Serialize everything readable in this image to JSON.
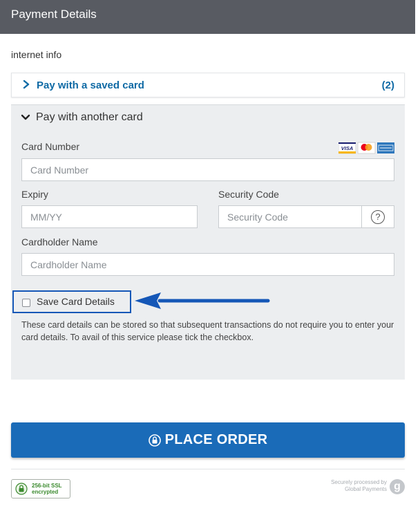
{
  "header": {
    "title": "Payment Details"
  },
  "merchant_info": "internet info",
  "saved_card": {
    "label": "Pay with a saved card",
    "count": "(2)"
  },
  "new_card": {
    "title": "Pay with another card",
    "card_number": {
      "label": "Card Number",
      "placeholder": "Card Number"
    },
    "card_logos": [
      "visa-logo",
      "mastercard-logo",
      "amex-logo"
    ],
    "expiry": {
      "label": "Expiry",
      "placeholder": "MM/YY"
    },
    "security_code": {
      "label": "Security Code",
      "placeholder": "Security Code",
      "help": "?"
    },
    "cardholder": {
      "label": "Cardholder Name",
      "placeholder": "Cardholder Name"
    },
    "save_card": {
      "label": "Save Card Details",
      "checked": false
    },
    "save_description": "These card details can be stored so that subsequent transactions do not require you to enter your card details. To avail of this service please tick the checkbox."
  },
  "place_order": {
    "label": "PLACE ORDER"
  },
  "footer": {
    "ssl_line1": "256-bit SSL",
    "ssl_line2": "encrypted",
    "processed_line1": "Securely processed by",
    "processed_line2": "Global Payments",
    "logo_letter": "g"
  },
  "colors": {
    "header_bg": "#585b62",
    "accent_blue": "#0f6aa5",
    "button_blue": "#1a6bb8",
    "annotation_blue": "#1557b7",
    "panel_bg": "#eceef0"
  }
}
